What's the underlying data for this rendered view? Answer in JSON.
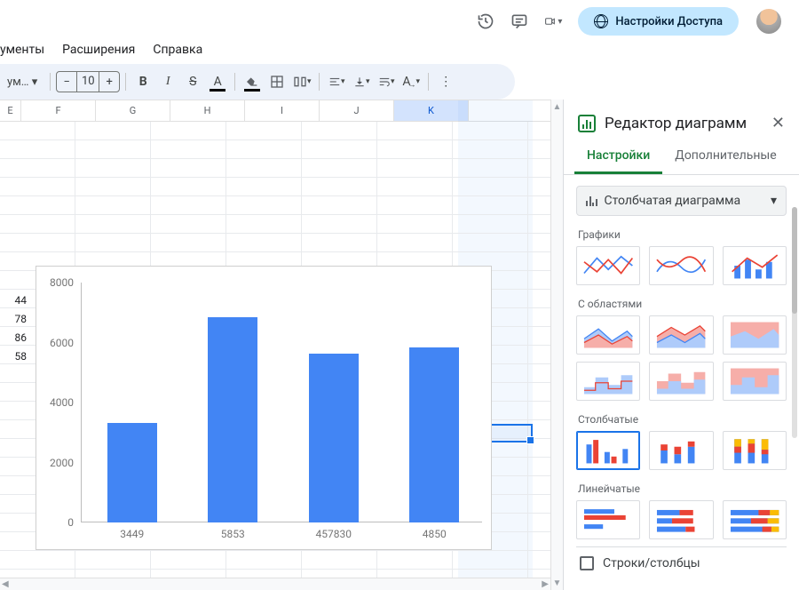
{
  "header": {
    "share_label": "Настройки Доступа"
  },
  "menubar": {
    "items": [
      "ументы",
      "Расширения",
      "Справка"
    ]
  },
  "toolbar": {
    "format_chip": "ум…",
    "font_size": "10"
  },
  "columns": [
    "E",
    "F",
    "G",
    "H",
    "I",
    "J",
    "K"
  ],
  "selected_column": "K",
  "cell_values": [
    "44",
    "78",
    "86",
    "58"
  ],
  "chart_data": {
    "type": "bar",
    "categories": [
      "3449",
      "5853",
      "457830",
      "4850"
    ],
    "values": [
      3300,
      6800,
      5600,
      5800
    ],
    "ylim": [
      0,
      8000
    ],
    "yticks": [
      0,
      2000,
      4000,
      6000,
      8000
    ],
    "title": "",
    "xlabel": "",
    "ylabel": ""
  },
  "panel": {
    "title": "Редактор диаграмм",
    "tabs": {
      "setup": "Настройки",
      "customize": "Дополнительные"
    },
    "chart_type_selected": "Столбчатая диаграмма",
    "sections": {
      "line": "Графики",
      "area": "С областями",
      "column": "Столбчатые",
      "bar": "Линейчатые"
    },
    "checkbox_rows_cols": "Строки/столбцы"
  }
}
